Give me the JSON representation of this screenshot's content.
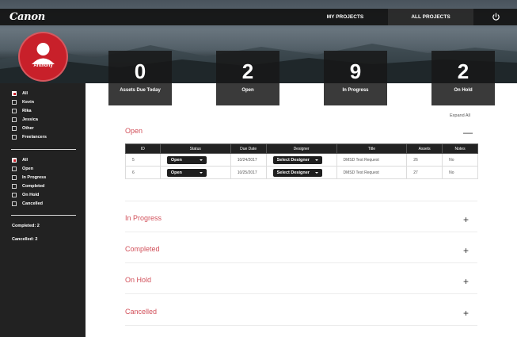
{
  "header": {
    "logo": "Canon",
    "nav": {
      "my_projects": "MY PROJECTS",
      "all_projects": "ALL PROJECTS"
    }
  },
  "user": {
    "name": "Anthony"
  },
  "stats": [
    {
      "value": "0",
      "label": "Assets Due Today"
    },
    {
      "value": "2",
      "label": "Open"
    },
    {
      "value": "9",
      "label": "In Progress"
    },
    {
      "value": "2",
      "label": "On Hold"
    }
  ],
  "sidebar": {
    "people": [
      {
        "label": "All",
        "checked": true
      },
      {
        "label": "Kevin",
        "checked": false
      },
      {
        "label": "Rika",
        "checked": false
      },
      {
        "label": "Jessica",
        "checked": false
      },
      {
        "label": "Other",
        "checked": false
      },
      {
        "label": "Freelancers",
        "checked": false
      }
    ],
    "statuses": [
      {
        "label": "All",
        "checked": true
      },
      {
        "label": "Open",
        "checked": false
      },
      {
        "label": "In Progress",
        "checked": false
      },
      {
        "label": "Completed",
        "checked": false
      },
      {
        "label": "On Hold",
        "checked": false
      },
      {
        "label": "Cancelled",
        "checked": false
      }
    ],
    "completed": "Completed: 2",
    "cancelled": "Cancelled: 2"
  },
  "main": {
    "expand_all": "Expand All",
    "open_section": {
      "title": "Open",
      "toggle": "—"
    },
    "table": {
      "headers": [
        "ID",
        "Status",
        "Due Date",
        "Designer",
        "Title",
        "Assets",
        "Notes"
      ],
      "rows": [
        {
          "id": "5",
          "status": "Open",
          "due": "10/24/2017",
          "designer": "Select Designer",
          "title": "DMSD Test Request",
          "assets": "26",
          "notes": "No"
        },
        {
          "id": "6",
          "status": "Open",
          "due": "10/25/2017",
          "designer": "Select Designer",
          "title": "DMSD Test Request",
          "assets": "27",
          "notes": "No"
        }
      ]
    },
    "sections": [
      {
        "title": "In Progress",
        "toggle": "+"
      },
      {
        "title": "Completed",
        "toggle": "+"
      },
      {
        "title": "On Hold",
        "toggle": "+"
      },
      {
        "title": "Cancelled",
        "toggle": "+"
      }
    ]
  },
  "colors": {
    "accent": "#c8202a",
    "section_title": "#d2505a",
    "dark": "#222222"
  }
}
